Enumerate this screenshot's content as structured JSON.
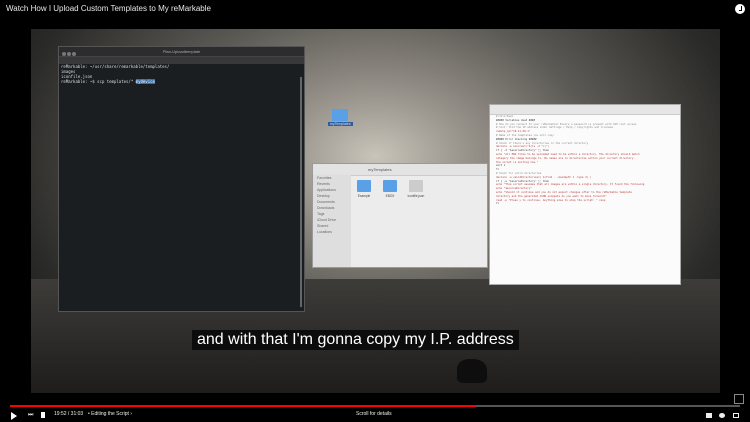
{
  "header": {
    "title": "Watch How I Upload Custom Templates to My reMarkable"
  },
  "desktop": {
    "terminal": {
      "title": "Plan-Uploadtemplate",
      "lines": [
        "reMarkable: ~/usr/share/remarkable/templates/",
        "images",
        "iconfile.json",
        "reMarkable: ~$ scp templates/* ",
        "mydevice"
      ]
    },
    "folder_label": "myTemplates",
    "finder": {
      "title": "myTemplates",
      "sidebar": [
        "Favorites",
        "Recents",
        "Applications",
        "Desktop",
        "Documents",
        "Downloads",
        "Tags",
        "iCloud Drive",
        "Shared",
        "Locations"
      ],
      "files": [
        "Example",
        "EBOX",
        "iconfile.json"
      ]
    },
    "editor": {
      "lines": [
        "#!/bin/bash",
        "##### Variables Used ####",
        "# How do you connect to your reMarkable? Ensure a password is present with SSH root access",
        "# hint: find the IP address under Settings / Help / Copyrights and licenses",
        "remote_ip=\"10.11.99.1\"",
        "# Name of the templates you will copy",
        "",
        "##### Error Checking #####",
        "# Check if there's any directories in the current directory",
        "declare -a sources=(\"$(ls -d */)\")",
        "if [ -d \"$sourceDirectory\" ]; then",
        "  echo \"All PNG files to be uploaded need to be within a directory. The directory should match",
        "  category the image belongs to. No names are in directories within your current directory.",
        "  the script is exiting now.\"",
        "  exit 1",
        "fi",
        "# Check for valid directories",
        "declare -a validDirectories=( $(find . -maxdepth 1 -type d) )",
        "if [ -e \"$sourceDirectory\" ]; then",
        "  echo \"This script assumes that all images are within a single directory. It found the following",
        "  echo \"$sourceDirectory\"",
        "  echo \"Should it continue and you do not expect changes after to the reMarkable template",
        "  directory and the generated JSON snippets do you want to move forward?\"",
        "  read -p \"Press y to continue. Anything else to stop the script: \" resp",
        "fi"
      ]
    }
  },
  "caption": "and with that I'm gonna copy my I.P. address",
  "player": {
    "time": "19:52 / 31:03",
    "chapter": "• Editing the Script ›",
    "scroll_label": "Scroll for details",
    "progress": 0.639
  }
}
